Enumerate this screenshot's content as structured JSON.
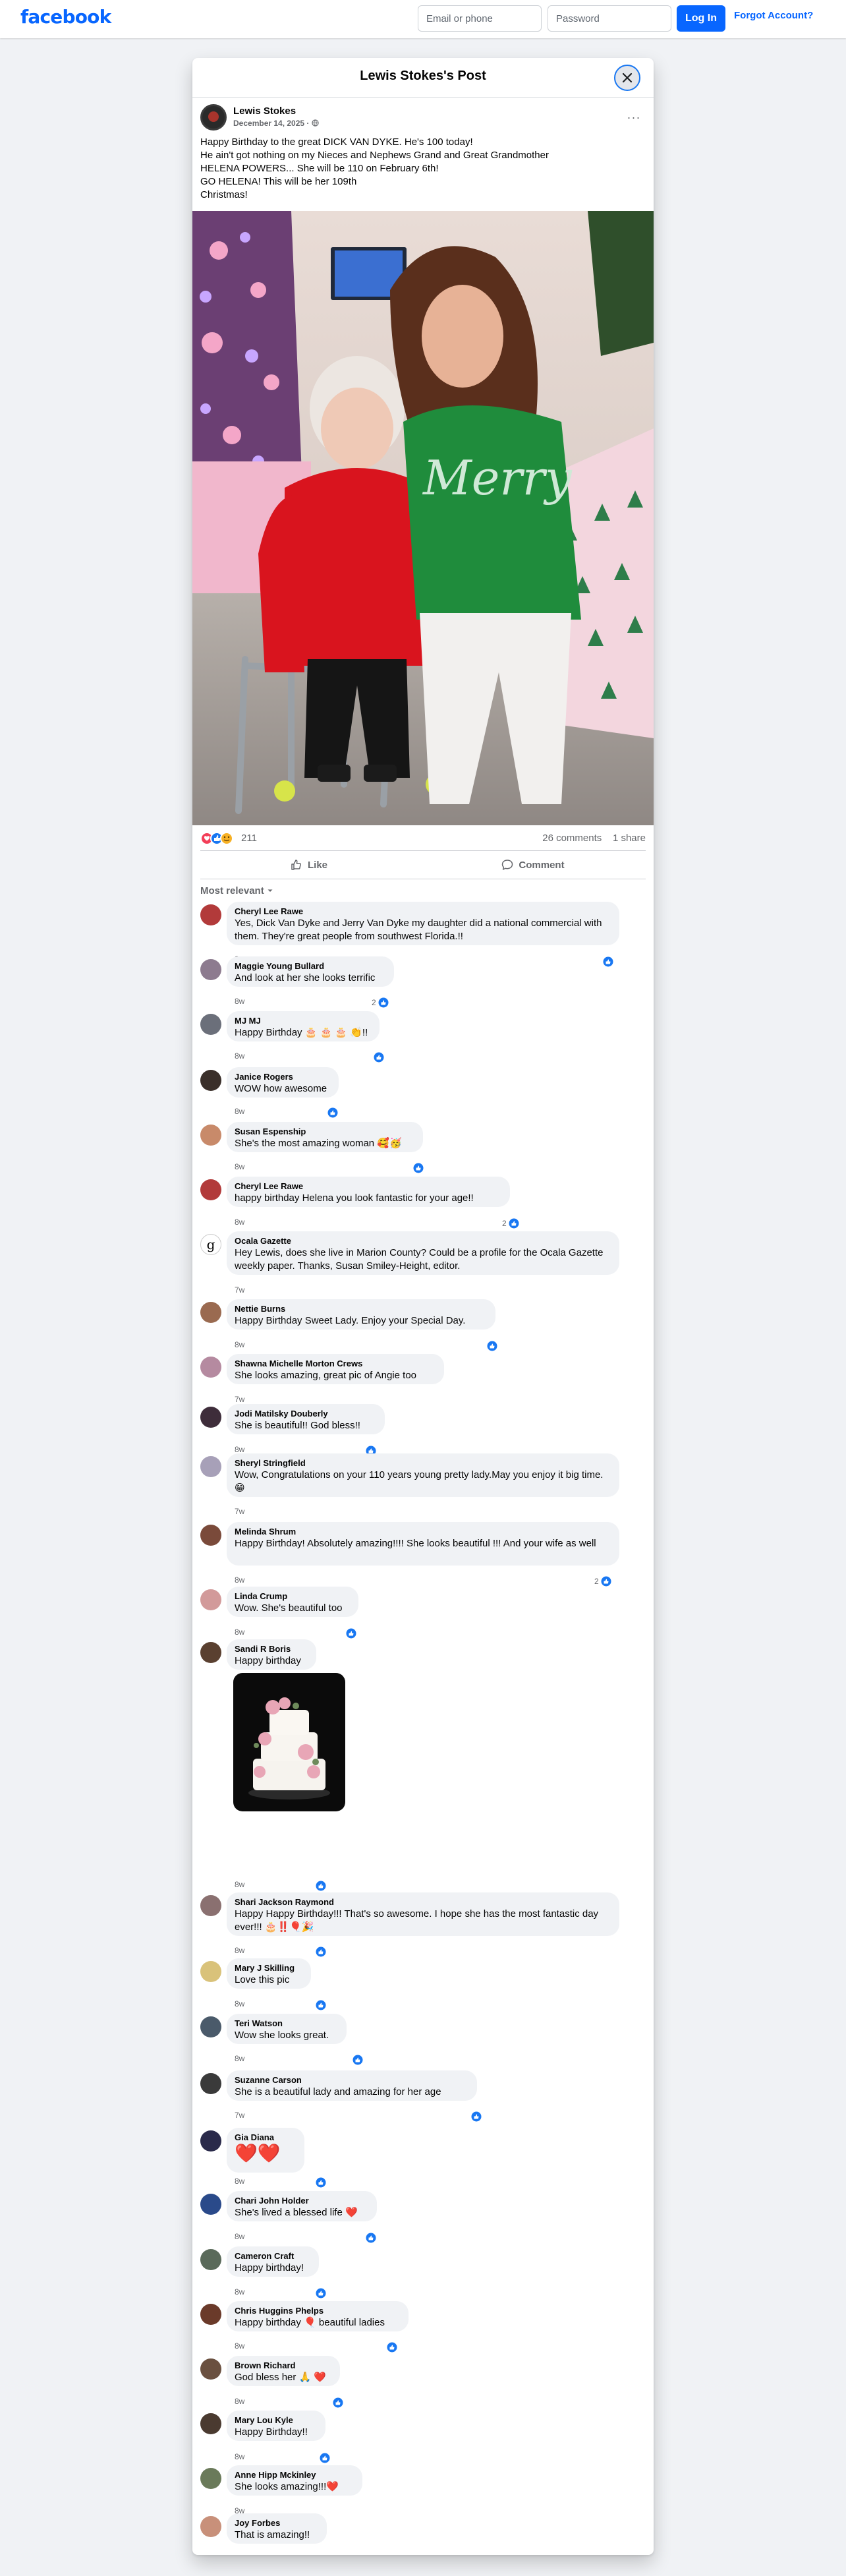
{
  "header": {
    "logo": "facebook",
    "email_placeholder": "Email or phone",
    "password_placeholder": "Password",
    "login_label": "Log In",
    "forgot_label": "Forgot Account?"
  },
  "modal": {
    "title": "Lewis Stokes's Post",
    "close_icon": "close-icon"
  },
  "post": {
    "author": "Lewis Stokes",
    "date": "December 14, 2025 · ",
    "privacy_icon": "globe-icon",
    "more_icon": "more-icon",
    "more_label": "···",
    "text": "Happy Birthday to the great  DICK VAN DYKE. He's 100 today!\nHe ain't got nothing on my Nieces and Nephews Grand and Great Grandmother\nHELENA POWERS... She will be 110 on February 6th!\nGO HELENA!  This will be her 109th\nChristmas!",
    "photo_caption": "Merry",
    "reaction_count": "211",
    "comments_count": "26 comments",
    "shares_count": "1 share",
    "like_label": "Like",
    "comment_label": "Comment",
    "sort_label": "Most relevant"
  },
  "colors": {
    "brand": "#0866ff",
    "like_blue": "#1877f2",
    "love_red": "#f33e58",
    "care_yellow": "#f7b125",
    "bubble_bg": "#f0f2f5"
  },
  "comments": [
    {
      "name": "Cheryl Lee Rawe",
      "text": "Yes, Dick Van Dyke and Jerry Van Dyke my daughter did a national commercial with them. They're great people from southwest Florida.!!",
      "time": "8w",
      "likes": ""
    },
    {
      "name": "Maggie Young Bullard",
      "text": "And look at her she looks terrific",
      "time": "8w",
      "likes": "2"
    },
    {
      "name": "MJ MJ",
      "text": "Happy Birthday 🎂 🎂 🎂 👏!!",
      "time": "8w",
      "likes": ""
    },
    {
      "name": "Janice Rogers",
      "text": "WOW how awesome",
      "time": "8w",
      "likes": ""
    },
    {
      "name": "Susan Espenship",
      "text": "She's the most amazing woman 🥰🥳",
      "time": "8w",
      "likes": ""
    },
    {
      "name": "Cheryl Lee Rawe",
      "text": "happy birthday Helena you look fantastic for your age!!",
      "time": "8w",
      "likes": "2"
    },
    {
      "name": "Ocala Gazette",
      "text": "Hey Lewis, does she live in Marion County? Could be a profile for the Ocala Gazette weekly paper. Thanks, Susan Smiley-Height, editor.",
      "time": "7w",
      "likes": ""
    },
    {
      "name": "Nettie Burns",
      "text": "Happy Birthday Sweet Lady. Enjoy your Special Day.",
      "time": "8w",
      "likes": ""
    },
    {
      "name": "Shawna Michelle Morton Crews",
      "text": "She looks amazing, great pic of Angie too",
      "time": "7w",
      "likes": ""
    },
    {
      "name": "Jodi Matilsky Douberly",
      "text": "She is beautiful!! God bless!!",
      "time": "8w",
      "likes": ""
    },
    {
      "name": "Sheryl Stringfield",
      "text": "Wow, Congratulations on your 110 years young pretty lady.May you enjoy it big time. 😁",
      "time": "7w",
      "likes": ""
    },
    {
      "name": "Melinda Shrum",
      "text": "Happy Birthday! Absolutely amazing!!!! She looks beautiful !!! And your wife as well",
      "time": "8w",
      "likes": "2"
    },
    {
      "name": "Linda Crump",
      "text": "Wow. She's beautiful too",
      "time": "8w",
      "likes": ""
    },
    {
      "name": "Sandi R Boris",
      "text": "Happy birthday",
      "time": "8w",
      "likes": ""
    },
    {
      "name": "Shari Jackson Raymond",
      "text": "Happy Happy Birthday!!! That's so awesome. I hope she has the most fantastic day ever!!! 🎂‼️🎈🎉",
      "time": "8w",
      "likes": ""
    },
    {
      "name": "Mary J Skilling",
      "text": "Love this pic",
      "time": "8w",
      "likes": ""
    },
    {
      "name": "Teri Watson",
      "text": "Wow she looks great.",
      "time": "8w",
      "likes": ""
    },
    {
      "name": "Suzanne Carson",
      "text": "She is a beautiful lady and amazing for her age",
      "time": "7w",
      "likes": ""
    },
    {
      "name": "Gia Diana",
      "text": "❤️❤️",
      "time": "8w",
      "likes": ""
    },
    {
      "name": "Chari John Holder",
      "text": "She's lived a blessed life ❤️",
      "time": "8w",
      "likes": ""
    },
    {
      "name": "Cameron Craft",
      "text": "Happy birthday!",
      "time": "8w",
      "likes": ""
    },
    {
      "name": "Chris Huggins Phelps",
      "text": "Happy birthday 🎈 beautiful ladies",
      "time": "8w",
      "likes": ""
    },
    {
      "name": "Brown Richard",
      "text": "God bless her 🙏 ❤️",
      "time": "8w",
      "likes": ""
    },
    {
      "name": "Mary Lou Kyle",
      "text": "Happy Birthday!!",
      "time": "8w",
      "likes": ""
    },
    {
      "name": "Anne Hipp Mckinley",
      "text": "She looks amazing!!!❤️",
      "time": "8w",
      "likes": ""
    },
    {
      "name": "Joy Forbes",
      "text": "That is amazing!!",
      "time": "8w",
      "likes": ""
    }
  ]
}
